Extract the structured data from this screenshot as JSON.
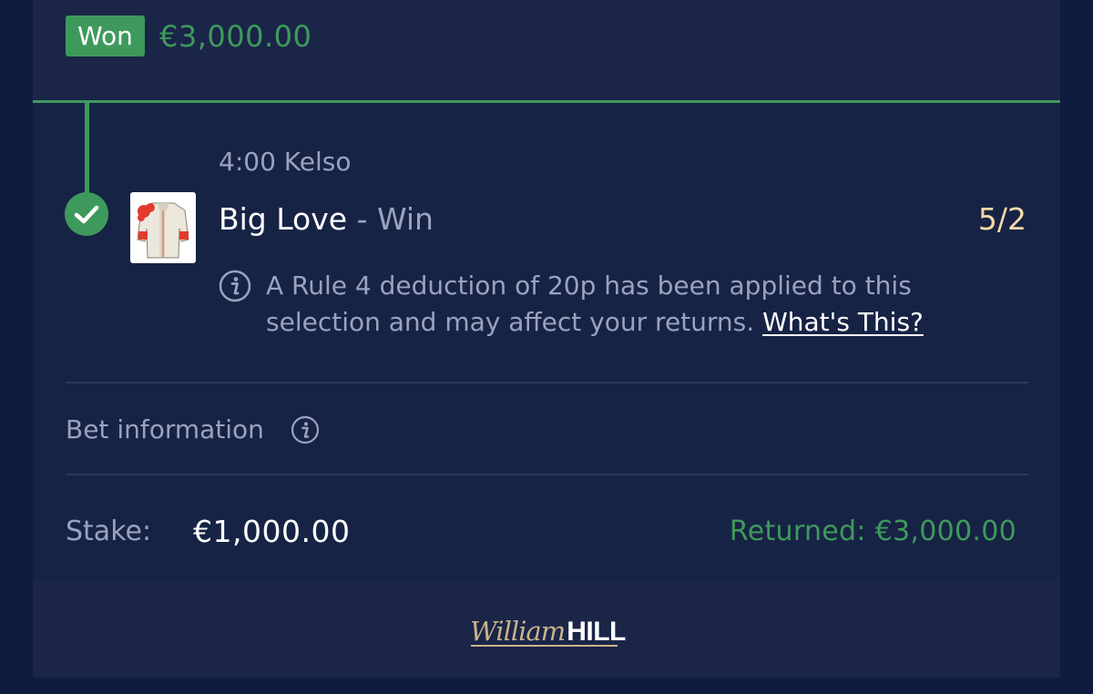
{
  "header": {
    "status_label": "Won",
    "winnings": "€3,000.00"
  },
  "selection": {
    "race": "4:00 Kelso",
    "horse": "Big Love",
    "separator": " - ",
    "market": "Win",
    "odds": "5/2",
    "status_icon": "check-icon",
    "silks_icon": "jockey-silks-icon"
  },
  "rule4_notice": {
    "text": "A Rule 4 deduction of 20p has been applied to this selection and may affect your returns.",
    "link_label": "What's This?",
    "icon": "info-icon"
  },
  "bet_information": {
    "label": "Bet information",
    "icon": "info-icon"
  },
  "summary": {
    "stake_label": "Stake:",
    "stake_value": "€1,000.00",
    "returned": "Returned: €3,000.00"
  },
  "footer": {
    "logo_script": "William",
    "logo_bold": "HILL"
  },
  "colors": {
    "background": "#0f1c3f",
    "panel": "#172345",
    "header_panel": "#1a2548",
    "won_green": "#3e9a5c",
    "odds_gold": "#f5d9a8",
    "muted_text": "#9aa3bd",
    "logo_gold": "#c9b38a"
  }
}
